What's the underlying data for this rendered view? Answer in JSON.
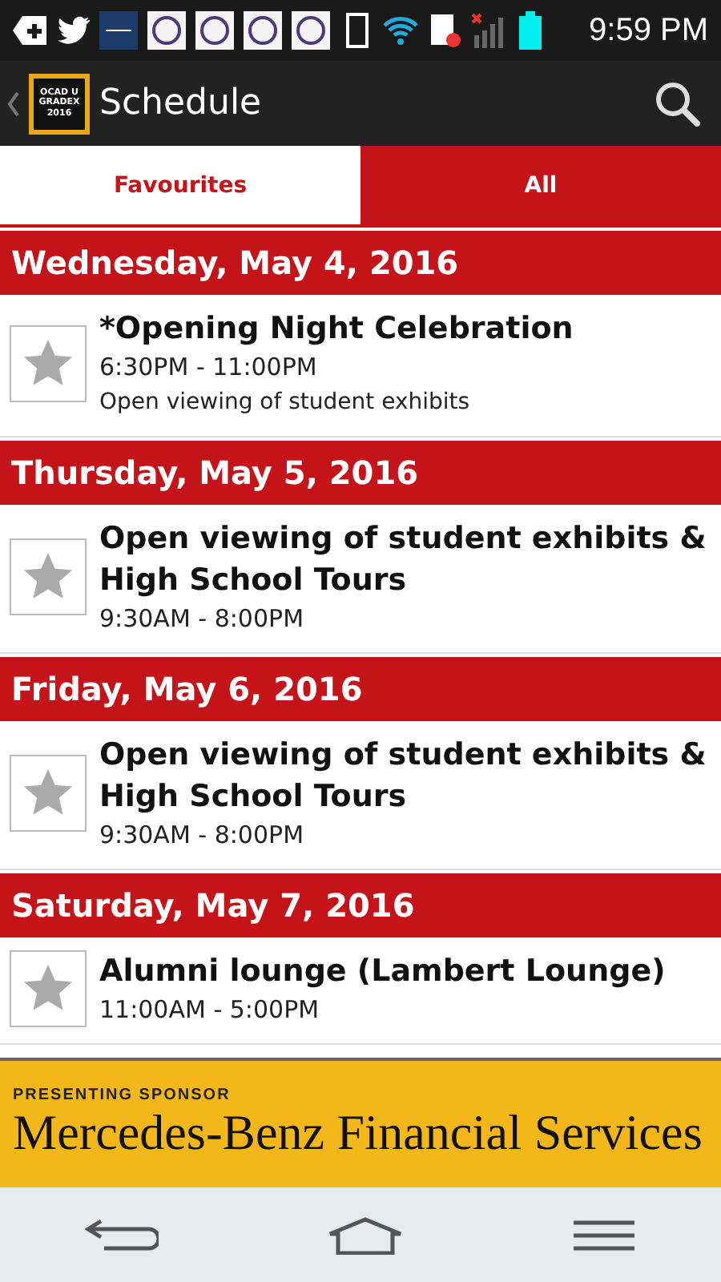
{
  "status_bar": {
    "time": "9:59 PM"
  },
  "app_bar": {
    "logo_lines": [
      "OCAD U",
      "GRADEX",
      "2016"
    ],
    "title": "Schedule"
  },
  "tabs": [
    {
      "label": "Favourites",
      "selected": false
    },
    {
      "label": "All",
      "selected": true
    }
  ],
  "days": [
    {
      "date": "Wednesday, May 4, 2016",
      "events": [
        {
          "title": "*Opening Night Celebration",
          "time": "6:30PM - 11:00PM",
          "description": "Open viewing of student exhibits",
          "favourite": false
        }
      ]
    },
    {
      "date": "Thursday, May 5, 2016",
      "events": [
        {
          "title": "Open viewing of student exhibits & High School Tours",
          "time": "9:30AM - 8:00PM",
          "favourite": false
        }
      ]
    },
    {
      "date": "Friday, May 6, 2016",
      "events": [
        {
          "title": "Open viewing of student exhibits & High School Tours",
          "time": "9:30AM - 8:00PM",
          "favourite": false
        }
      ]
    },
    {
      "date": "Saturday, May 7, 2016",
      "events": [
        {
          "title": "Alumni lounge (Lambert Lounge)",
          "time": "11:00AM - 5:00PM",
          "favourite": false
        }
      ]
    }
  ],
  "sponsor": {
    "label": "PRESENTING SPONSOR",
    "name": "Mercedes-Benz Financial Services"
  }
}
